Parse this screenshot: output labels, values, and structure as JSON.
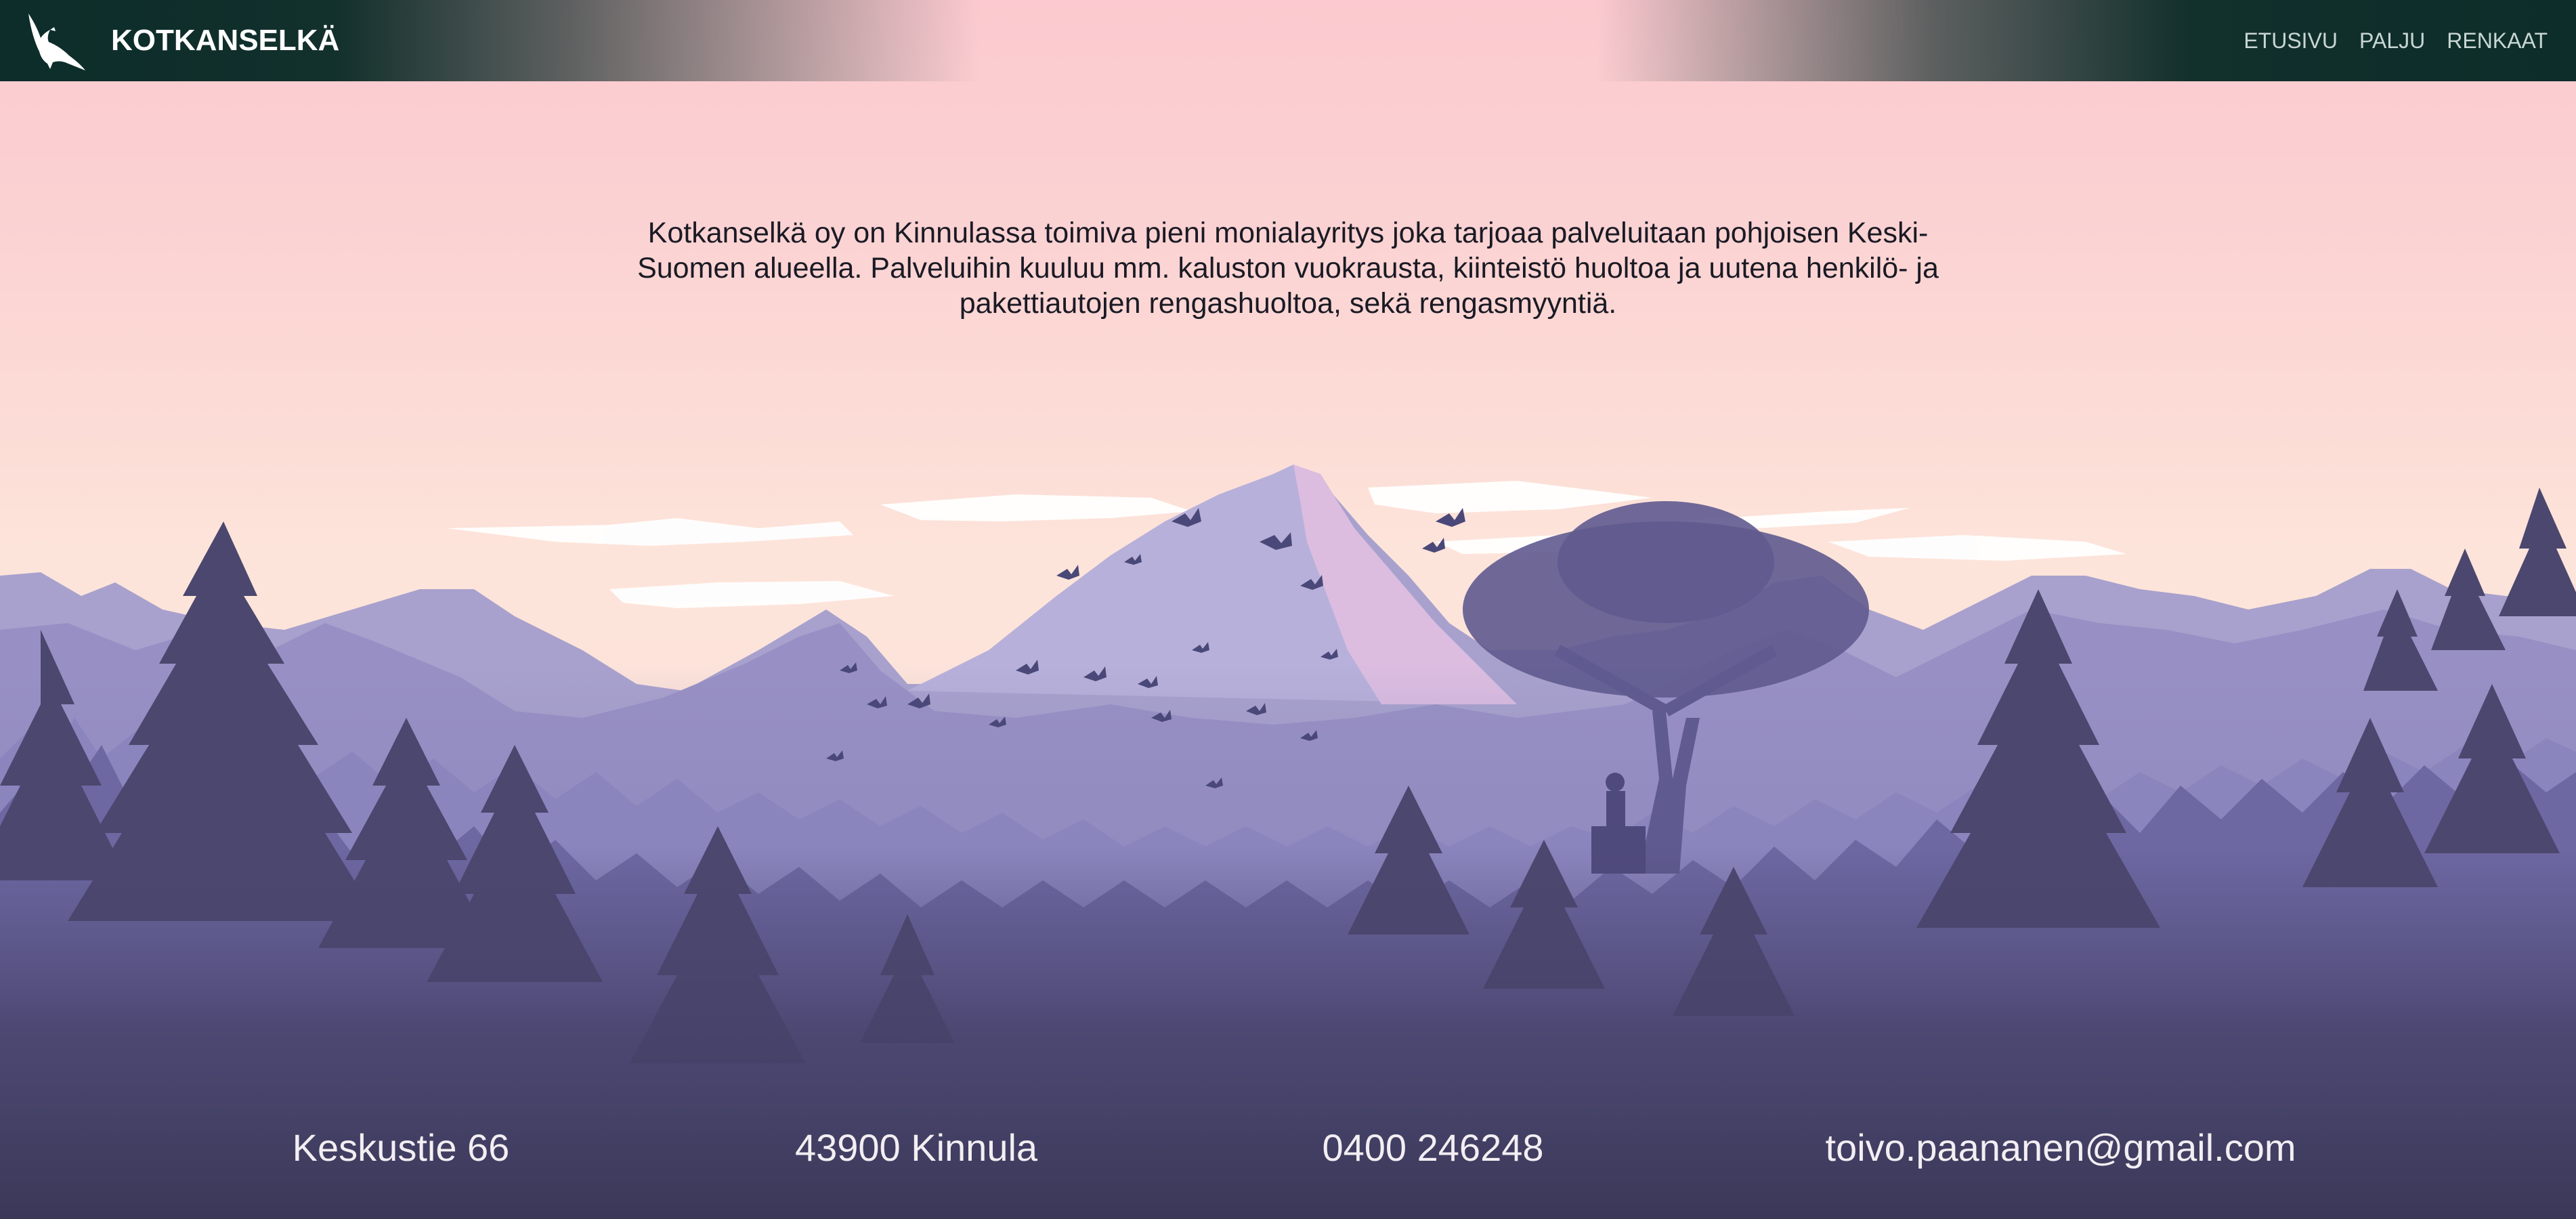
{
  "header": {
    "brand": "KOTKANSELKÄ",
    "logo_icon": "eagle-icon",
    "nav": [
      {
        "label": "ETUSIVU"
      },
      {
        "label": "PALJU"
      },
      {
        "label": "RENKAAT"
      }
    ]
  },
  "main": {
    "intro": "Kotkanselkä oy on Kinnulassa toimiva pieni monialayritys joka tarjoaa palveluitaan pohjoisen Keski-Suomen alueella. Palveluihin kuuluu mm. kaluston vuokrausta, kiinteistö huoltoa ja uutena henkilö- ja pakettiautojen rengashuoltoa, sekä rengasmyyntiä."
  },
  "footer": {
    "address": "Keskustie 66",
    "city": "43900 Kinnula",
    "phone": "0400 246248",
    "email": "toivo.paananen@gmail.com"
  },
  "colors": {
    "header_dark": "#0c2d2a",
    "sky_top": "#fbc9cf",
    "mountain_far": "#a89fc8",
    "forest_dark": "#3e3c5e"
  }
}
